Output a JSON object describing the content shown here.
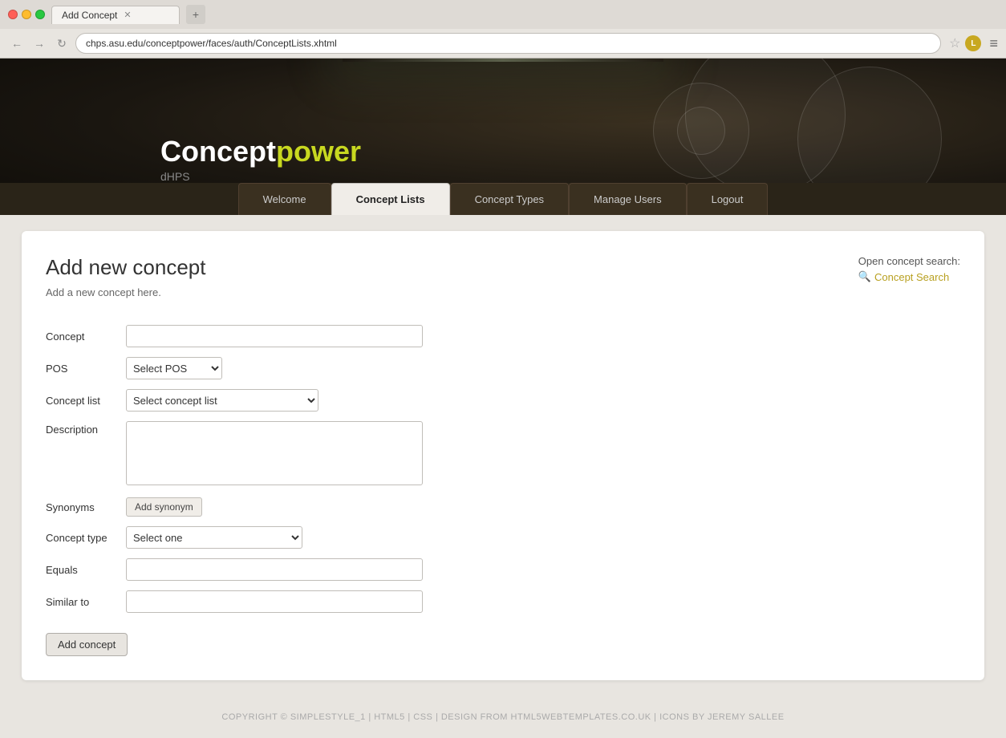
{
  "browser": {
    "tab_title": "Add Concept",
    "url": "chps.asu.edu/conceptpower/faces/auth/ConceptLists.xhtml",
    "new_tab_icon": "+"
  },
  "header": {
    "logo_text_normal": "Concept",
    "logo_text_yellow": "power",
    "logo_sub": "dHPS"
  },
  "nav": {
    "tabs": [
      {
        "id": "welcome",
        "label": "Welcome",
        "active": false
      },
      {
        "id": "concept-lists",
        "label": "Concept Lists",
        "active": true
      },
      {
        "id": "concept-types",
        "label": "Concept Types",
        "active": false
      },
      {
        "id": "manage-users",
        "label": "Manage Users",
        "active": false
      },
      {
        "id": "logout",
        "label": "Logout",
        "active": false
      }
    ]
  },
  "main": {
    "title": "Add new concept",
    "subtitle": "Add a new concept here.",
    "concept_search_label": "Open concept search:",
    "concept_search_link": "Concept Search",
    "form": {
      "concept_label": "Concept",
      "concept_placeholder": "",
      "pos_label": "POS",
      "pos_placeholder": "Select POS",
      "concept_list_label": "Concept list",
      "concept_list_placeholder": "Select concept list",
      "description_label": "Description",
      "synonyms_label": "Synonyms",
      "add_synonym_label": "Add synonym",
      "concept_type_label": "Concept type",
      "concept_type_placeholder": "Select one",
      "equals_label": "Equals",
      "similar_to_label": "Similar to",
      "add_concept_btn": "Add concept"
    }
  },
  "footer": {
    "text": "COPYRIGHT © SIMPLESTYLE_1 | HTML5 | CSS | DESIGN FROM HTML5WEBTEMPLATES.CO.UK | ICONS BY JEREMY SALLEE"
  }
}
